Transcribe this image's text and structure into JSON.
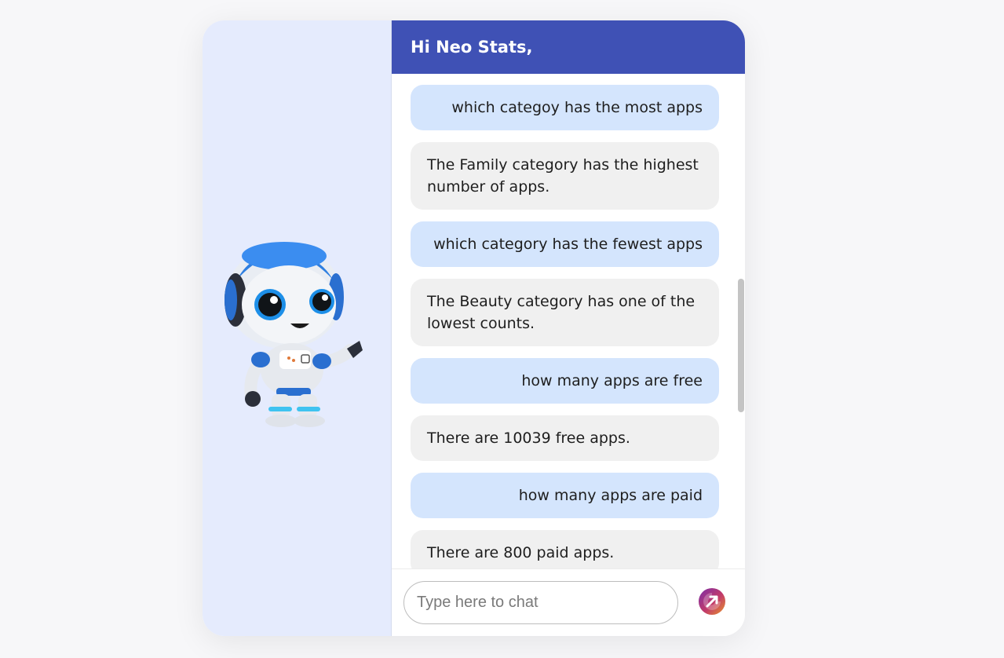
{
  "header": {
    "greeting": "Hi Neo Stats,"
  },
  "messages": [
    {
      "role": "user",
      "text": "which categoy has the most apps"
    },
    {
      "role": "bot",
      "text": "The Family category has the highest number of apps."
    },
    {
      "role": "user",
      "text": "which category has the fewest apps"
    },
    {
      "role": "bot",
      "text": "The Beauty category has one of the lowest counts."
    },
    {
      "role": "user",
      "text": "how many apps are free"
    },
    {
      "role": "bot",
      "text": "There are 10039 free apps."
    },
    {
      "role": "user",
      "text": "how many apps are paid"
    },
    {
      "role": "bot",
      "text": "There are 800 paid apps."
    }
  ],
  "composer": {
    "placeholder": "Type here to chat",
    "value": ""
  },
  "colors": {
    "header_bg": "#3f51b5",
    "user_bubble": "#d4e5fd",
    "bot_bubble": "#f0f0f0",
    "left_pane_bg": "#e5ebfd"
  },
  "icons": {
    "mascot": "robot-mascot",
    "send": "send-arrow-icon"
  }
}
